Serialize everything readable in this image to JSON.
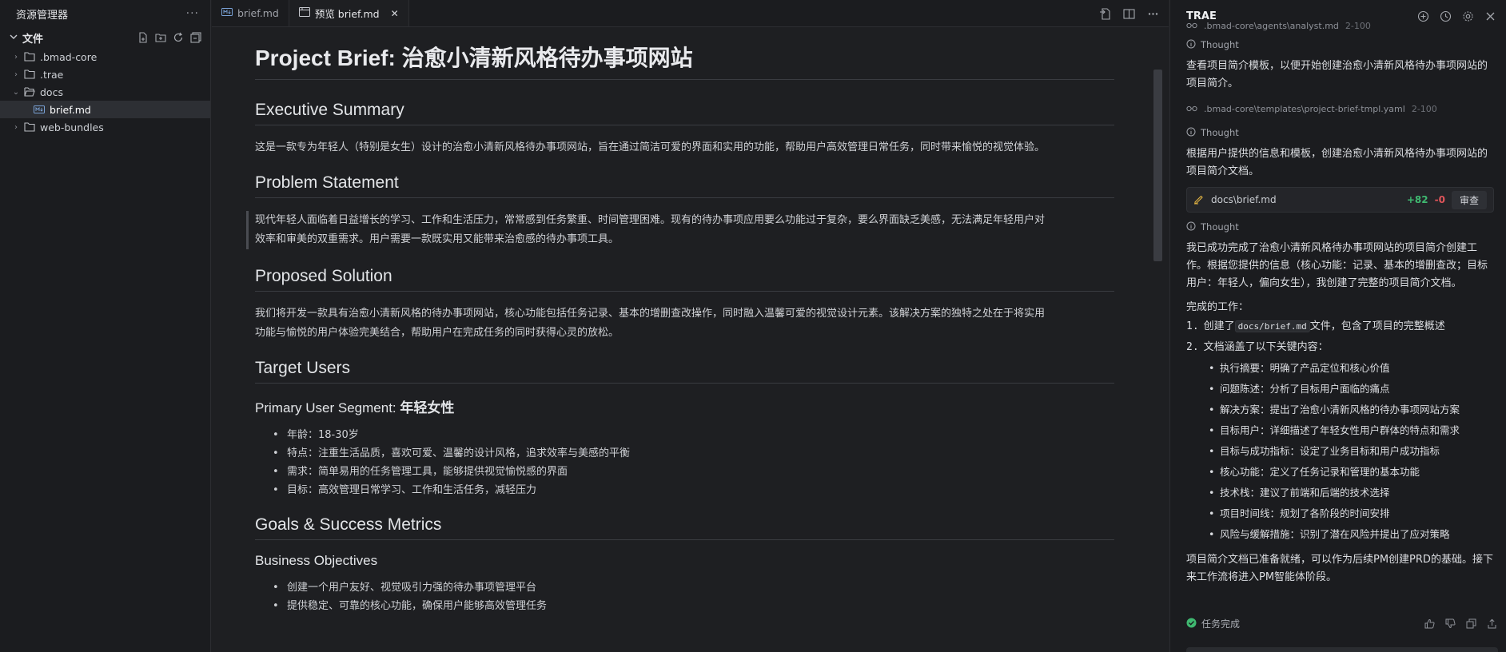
{
  "explorer": {
    "title": "资源管理器",
    "more": "···",
    "files_label": "文件",
    "items": [
      {
        "label": ".bmad-core",
        "type": "folder",
        "open": false
      },
      {
        "label": ".trae",
        "type": "folder",
        "open": false
      },
      {
        "label": "docs",
        "type": "folder",
        "open": true
      },
      {
        "label": "brief.md",
        "type": "file",
        "active": true
      },
      {
        "label": "web-bundles",
        "type": "folder",
        "open": false
      }
    ]
  },
  "tabs": [
    {
      "label": "brief.md",
      "active": false
    },
    {
      "label": "预览 brief.md",
      "active": true,
      "close": "✕"
    }
  ],
  "doc": {
    "title_prefix": "Project Brief: ",
    "title_cn": "治愈小清新风格待办事项网站",
    "exec_summary_h": "Executive Summary",
    "exec_summary_p": "这是一款专为年轻人（特别是女生）设计的治愈小清新风格待办事项网站，旨在通过简洁可爱的界面和实用的功能，帮助用户高效管理日常任务，同时带来愉悦的视觉体验。",
    "problem_h": "Problem Statement",
    "problem_p1": "现代年轻人面临着日益增长的学习、工作和生活压力，常常感到任务繁重、时间管理困难。现有的待办事项应用要么功能过于复杂，要么界面缺乏美感，无法满足年轻用户对",
    "problem_p2": "效率和审美的双重需求。用户需要一款既实用又能带来治愈感的待办事项工具。",
    "solution_h": "Proposed Solution",
    "solution_p1": "我们将开发一款具有治愈小清新风格的待办事项网站，核心功能包括任务记录、基本的增删查改操作，同时融入温馨可爱的视觉设计元素。该解决方案的独特之处在于将实用",
    "solution_p2": "功能与愉悦的用户体验完美结合，帮助用户在完成任务的同时获得心灵的放松。",
    "target_h": "Target Users",
    "primary_h_prefix": "Primary User Segment: ",
    "primary_h_cn": "年轻女性",
    "primary_items": [
      "年龄：18-30岁",
      "特点：注重生活品质，喜欢可爱、温馨的设计风格，追求效率与美感的平衡",
      "需求：简单易用的任务管理工具，能够提供视觉愉悦感的界面",
      "目标：高效管理日常学习、工作和生活任务，减轻压力"
    ],
    "goals_h": "Goals & Success Metrics",
    "business_h": "Business Objectives",
    "business_items": [
      "创建一个用户友好、视觉吸引力强的待办事项管理平台",
      "提供稳定、可靠的核心功能，确保用户能够高效管理任务"
    ]
  },
  "panel": {
    "title": "TRAE",
    "top_ref": {
      "path": ".bmad-core\\agents\\analyst.md",
      "range": "2-100"
    },
    "thought_label": "Thought",
    "msg1": "查看项目简介模板，以便开始创建治愈小清新风格待办事项网站的项目简介。",
    "ref2": {
      "path": ".bmad-core\\templates\\project-brief-tmpl.yaml",
      "range": "2-100"
    },
    "msg2": "根据用户提供的信息和模板，创建治愈小清新风格待办事项网站的项目简介文档。",
    "change": {
      "path": "docs\\brief.md",
      "plus": "+82",
      "minus": "-0",
      "review": "审查"
    },
    "msg3": "我已成功完成了治愈小清新风格待办事项网站的项目简介创建工作。根据您提供的信息（核心功能：记录、基本的增删查改；目标用户：年轻人，偏向女生），我创建了完整的项目简介文档。",
    "done_label": "完成的工作：",
    "step1_num": "1.",
    "step1_pre": "创建了",
    "step1_code": "docs/brief.md",
    "step1_post": "文件，包含了项目的完整概述",
    "step2_num": "2.",
    "step2": "文档涵盖了以下关键内容：",
    "bullets": [
      "执行摘要：明确了产品定位和核心价值",
      "问题陈述：分析了目标用户面临的痛点",
      "解决方案：提出了治愈小清新风格的待办事项网站方案",
      "目标用户：详细描述了年轻女性用户群体的特点和需求",
      "目标与成功指标：设定了业务目标和用户成功指标",
      "核心功能：定义了任务记录和管理的基本功能",
      "技术栈：建议了前端和后端的技术选择",
      "项目时间线：规划了各阶段的时间安排",
      "风险与缓解措施：识别了潜在风险并提出了应对策略"
    ],
    "final": "项目简介文档已准备就绪，可以作为后续PM创建PRD的基础。接下来工作流将进入PM智能体阶段。",
    "status": "任务完成"
  }
}
